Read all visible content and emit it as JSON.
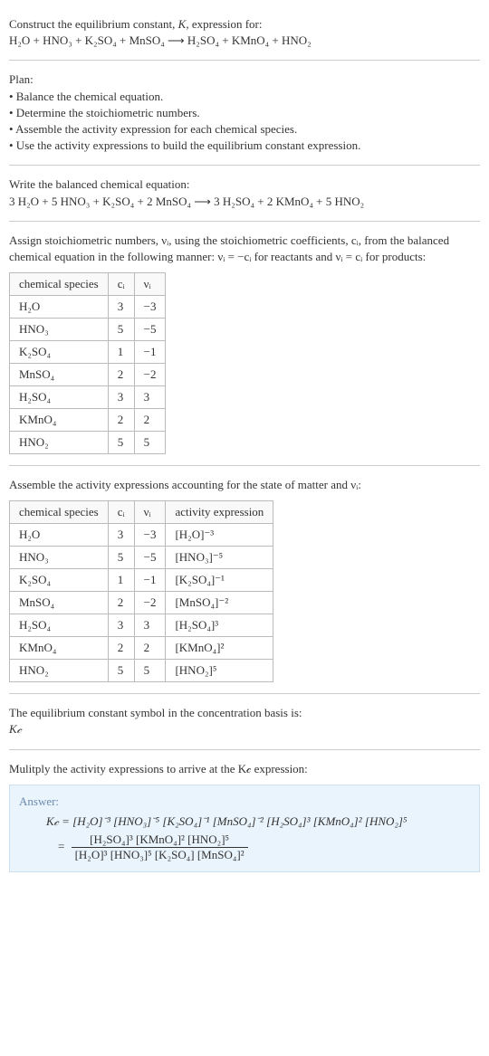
{
  "intro": {
    "prompt_prefix": "Construct the equilibrium constant, ",
    "K": "K",
    "prompt_suffix": ", expression for:",
    "equation_unbalanced": "H₂O + HNO₃ + K₂SO₄ + MnSO₄  ⟶  H₂SO₄ + KMnO₄ + HNO₂"
  },
  "plan": {
    "label": "Plan:",
    "items": [
      "• Balance the chemical equation.",
      "• Determine the stoichiometric numbers.",
      "• Assemble the activity expression for each chemical species.",
      "• Use the activity expressions to build the equilibrium constant expression."
    ]
  },
  "balanced": {
    "label": "Write the balanced chemical equation:",
    "equation": "3 H₂O + 5 HNO₃ + K₂SO₄ + 2 MnSO₄  ⟶  3 H₂SO₄ + 2 KMnO₄ + 5 HNO₂"
  },
  "stoich_intro": "Assign stoichiometric numbers, νᵢ, using the stoichiometric coefficients, cᵢ, from the balanced chemical equation in the following manner: νᵢ = −cᵢ for reactants and νᵢ = cᵢ for products:",
  "stoich_table": {
    "headers": [
      "chemical species",
      "cᵢ",
      "νᵢ"
    ],
    "rows": [
      {
        "sp": "H₂O",
        "c": "3",
        "v": "−3"
      },
      {
        "sp": "HNO₃",
        "c": "5",
        "v": "−5"
      },
      {
        "sp": "K₂SO₄",
        "c": "1",
        "v": "−1"
      },
      {
        "sp": "MnSO₄",
        "c": "2",
        "v": "−2"
      },
      {
        "sp": "H₂SO₄",
        "c": "3",
        "v": "3"
      },
      {
        "sp": "KMnO₄",
        "c": "2",
        "v": "2"
      },
      {
        "sp": "HNO₂",
        "c": "5",
        "v": "5"
      }
    ]
  },
  "activity_intro": "Assemble the activity expressions accounting for the state of matter and νᵢ:",
  "activity_table": {
    "headers": [
      "chemical species",
      "cᵢ",
      "νᵢ",
      "activity expression"
    ],
    "rows": [
      {
        "sp": "H₂O",
        "c": "3",
        "v": "−3",
        "a": "[H₂O]⁻³"
      },
      {
        "sp": "HNO₃",
        "c": "5",
        "v": "−5",
        "a": "[HNO₃]⁻⁵"
      },
      {
        "sp": "K₂SO₄",
        "c": "1",
        "v": "−1",
        "a": "[K₂SO₄]⁻¹"
      },
      {
        "sp": "MnSO₄",
        "c": "2",
        "v": "−2",
        "a": "[MnSO₄]⁻²"
      },
      {
        "sp": "H₂SO₄",
        "c": "3",
        "v": "3",
        "a": "[H₂SO₄]³"
      },
      {
        "sp": "KMnO₄",
        "c": "2",
        "v": "2",
        "a": "[KMnO₄]²"
      },
      {
        "sp": "HNO₂",
        "c": "5",
        "v": "5",
        "a": "[HNO₂]⁵"
      }
    ]
  },
  "symbol": {
    "line1": "The equilibrium constant symbol in the concentration basis is:",
    "line2": "K𝒸"
  },
  "multiply": "Mulitply the activity expressions to arrive at the K𝒸 expression:",
  "answer": {
    "label": "Answer:",
    "line1": "K𝒸 = [H₂O]⁻³ [HNO₃]⁻⁵ [K₂SO₄]⁻¹ [MnSO₄]⁻² [H₂SO₄]³ [KMnO₄]² [HNO₂]⁵",
    "eq": "= ",
    "num": "[H₂SO₄]³ [KMnO₄]² [HNO₂]⁵",
    "den": "[H₂O]³ [HNO₃]⁵ [K₂SO₄] [MnSO₄]²"
  },
  "chart_data": {
    "type": "table",
    "title": "Stoichiometric numbers",
    "columns": [
      "chemical species",
      "cᵢ",
      "νᵢ"
    ],
    "rows": [
      [
        "H₂O",
        3,
        -3
      ],
      [
        "HNO₃",
        5,
        -5
      ],
      [
        "K₂SO₄",
        1,
        -1
      ],
      [
        "MnSO₄",
        2,
        -2
      ],
      [
        "H₂SO₄",
        3,
        3
      ],
      [
        "KMnO₄",
        2,
        2
      ],
      [
        "HNO₂",
        5,
        5
      ]
    ]
  }
}
